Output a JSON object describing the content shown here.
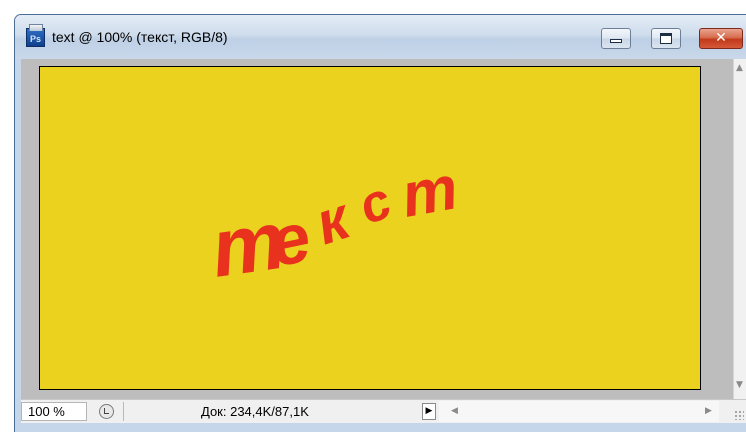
{
  "window": {
    "title": "text @ 100% (текст, RGB/8)",
    "app_icon_label": "Ps",
    "minimize_icon": "minimize-icon",
    "maximize_icon": "maximize-icon",
    "close_icon": "close-icon",
    "close_glyph": "✕"
  },
  "canvas": {
    "background_color": "#ebd21f",
    "text": "текст",
    "text_color": "#e8321d",
    "letters": [
      "т",
      "е",
      "к",
      "с",
      "т"
    ]
  },
  "status": {
    "zoom": "100 %",
    "doc_info": "Док: 234,4K/87,1K",
    "status_icon": "preview-status-icon",
    "menu_arrow": "▶"
  },
  "scrollbars": {
    "up": "▲",
    "down": "▼",
    "left": "◀",
    "right": "▶"
  }
}
